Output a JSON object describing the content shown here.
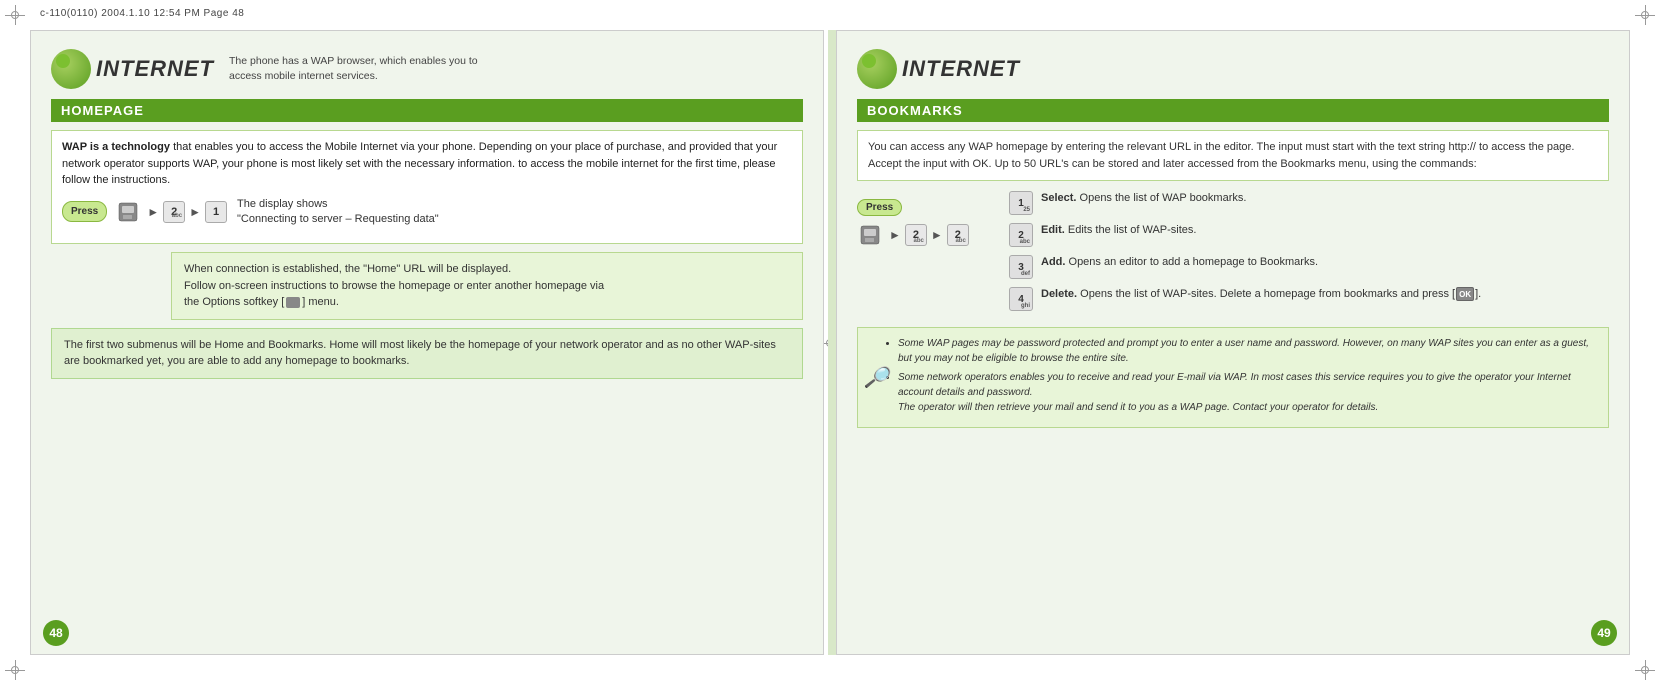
{
  "header": {
    "text": "c-110(0110)   2004.1.10   12:54 PM   Page 48"
  },
  "page_left": {
    "page_number": "48",
    "internet_title": "INTERNET",
    "internet_desc": "The phone has a WAP browser, which enables you to access mobile internet services.",
    "section_title": "HOMEPAGE",
    "content_intro": "WAP is a technology that enables you to access the Mobile Internet via your phone. Depending on your place of purchase, and provided that your network operator supports WAP, your phone is most likely set with the necessary information. to access the mobile internet for the first time, please follow the instructions.",
    "press_label": "Press",
    "display_shows_line1": "The display shows",
    "display_shows_line2": "\"Connecting to server – Requesting data\"",
    "callout_text": "When connection is established, the \"Home\" URL will be displayed.\nFollow on-screen instructions to browse the homepage or enter another homepage via the Options softkey [   ] menu.",
    "bottom_info": "The first two submenus will be Home and Bookmarks. Home will most likely be the homepage of your network operator and as no other WAP-sites are bookmarked yet, you are able to add any homepage to bookmarks.",
    "keys": [
      "2abc",
      "1"
    ]
  },
  "page_right": {
    "page_number": "49",
    "internet_title": "INTERNET",
    "section_title": "BOOKMARKS",
    "intro_text": "You can access any WAP homepage by entering the relevant URL in the editor. The input must start with the text string http:// to access the page. Accept the input with OK. Up to 50 URL's can be stored and later accessed from the Bookmarks menu, using the commands:",
    "press_label": "Press",
    "press_keys": [
      "2abc",
      "2abc"
    ],
    "bookmarks": [
      {
        "key": "1",
        "key_sub": "25",
        "bold_text": "Select.",
        "text": " Opens the list of WAP bookmarks."
      },
      {
        "key": "2",
        "key_sub": "abc",
        "bold_text": "Edit.",
        "text": " Edits the list of WAP-sites."
      },
      {
        "key": "3",
        "key_sub": "def",
        "bold_text": "Add.",
        "text": "  Opens an editor to add a homepage to Bookmarks."
      },
      {
        "key": "4",
        "key_sub": "ghi",
        "bold_text": "Delete.",
        "text": " Opens the list of WAP-sites. Delete a homepage from bookmarks and press [    ]."
      }
    ],
    "notes": [
      "Some WAP pages may be password protected and prompt you to enter a user name and password. However, on many WAP sites you can enter as a guest, but you may not be eligible to browse the entire site.",
      "Some network operators enables you to receive and read your E-mail via WAP. In most cases this service requires you to give the operator your Internet account details and password.\nThe operator will then retrieve your mail and send it to you as a WAP page. Contact your operator for details."
    ]
  }
}
